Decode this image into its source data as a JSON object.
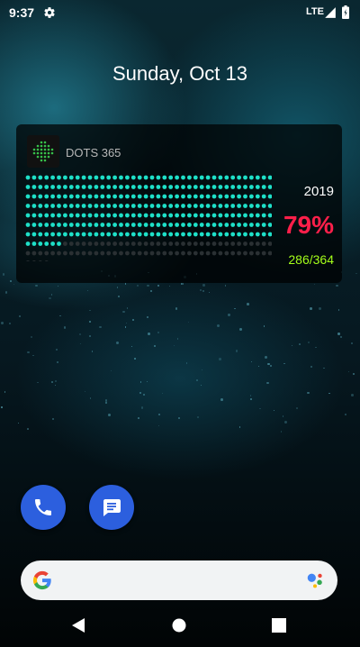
{
  "status_bar": {
    "time": "9:37",
    "network": "LTE",
    "icons": [
      "gear-icon",
      "signal-icon",
      "battery-icon"
    ]
  },
  "date_text": "Sunday, Oct 13",
  "widget": {
    "app_name": "DOTS 365",
    "year": "2019",
    "percent": "79%",
    "count": "286/364",
    "days_elapsed": 286,
    "days_total": 364,
    "colors": {
      "elapsed": "#1ee0c8",
      "remaining": "#2a3033",
      "percent": "#ff1f4a",
      "count": "#a5ff1a"
    }
  },
  "dock": {
    "apps": [
      "phone-icon",
      "messages-icon"
    ],
    "color": "#2c5fde"
  },
  "search_bar": {
    "icons": [
      "google-icon",
      "assistant-icon"
    ]
  },
  "nav_bar": {
    "icons": [
      "back-icon",
      "home-icon",
      "recents-icon"
    ]
  }
}
